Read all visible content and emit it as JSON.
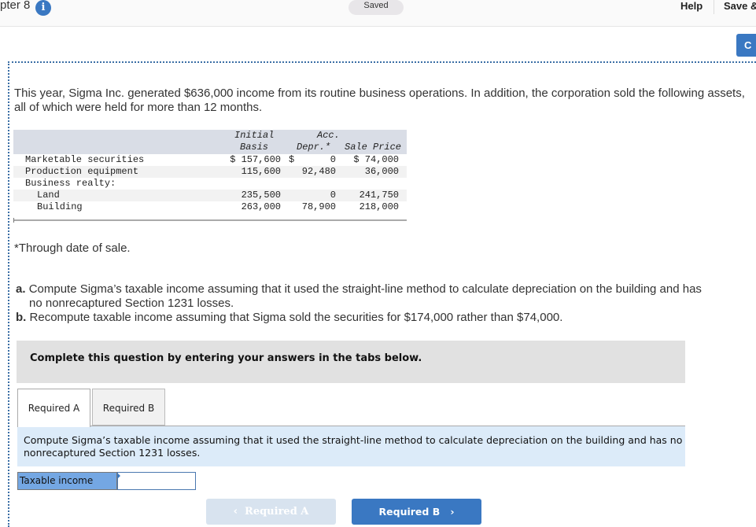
{
  "header": {
    "chapter": "pter 8",
    "info_icon": "info-icon",
    "saved_badge": "Saved",
    "help": "Help",
    "save_exit": "Save &",
    "check_button": "C"
  },
  "problem": {
    "intro": "This year, Sigma Inc. generated $636,000 income from its routine business operations. In addition, the corporation sold the following assets, all of which were held for more than 12 months.",
    "table": {
      "headers": {
        "initial_basis_1": "Initial",
        "initial_basis_2": "Basis",
        "acc_depr_1": "Acc.",
        "acc_depr_2": "Depr.*",
        "sale_price": "Sale Price"
      },
      "rows": [
        {
          "asset": "Marketable securities",
          "basis": "$ 157,600",
          "depr_sym": "$",
          "depr": "0",
          "price": "$ 74,000"
        },
        {
          "asset": "Production equipment",
          "basis": "115,600",
          "depr_sym": "",
          "depr": "92,480",
          "price": "36,000"
        },
        {
          "asset": "Business realty:",
          "basis": "",
          "depr_sym": "",
          "depr": "",
          "price": ""
        },
        {
          "asset": "Land",
          "basis": "235,500",
          "depr_sym": "",
          "depr": "0",
          "price": "241,750"
        },
        {
          "asset": "Building",
          "basis": "263,000",
          "depr_sym": "",
          "depr": "78,900",
          "price": "218,000"
        }
      ]
    },
    "footnote": "*Through date of sale.",
    "part_a_label": "a.",
    "part_a": "Compute Sigma’s taxable income assuming that it used the straight-line method to calculate depreciation on the building and has",
    "part_a_cont": "no nonrecaptured Section 1231 losses.",
    "part_b_label": "b.",
    "part_b": "Recompute taxable income assuming that Sigma sold the securities for $174,000 rather than $74,000."
  },
  "instructions": "Complete this question by entering your answers in the tabs below.",
  "tabs": [
    {
      "label": "Required A",
      "active": true
    },
    {
      "label": "Required B",
      "active": false
    }
  ],
  "tab_panel": {
    "text": "Compute Sigma’s taxable income assuming that it used the straight-line method to calculate depreciation on the building and has no nonrecaptured Section 1231 losses."
  },
  "answer": {
    "label": "Taxable income",
    "value": ""
  },
  "navigation": {
    "prev_label": "Required A",
    "next_label": "Required B",
    "prev_icon": "‹",
    "next_icon": "›"
  }
}
